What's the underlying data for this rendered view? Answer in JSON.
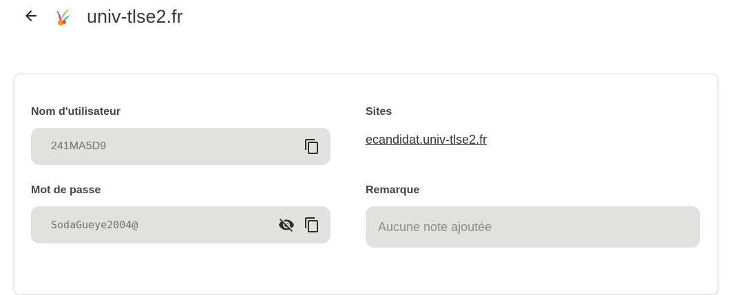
{
  "header": {
    "site_title": "univ-tlse2.fr",
    "back_icon": "arrow-left-icon",
    "logo_icon": "site-favicon"
  },
  "fields": {
    "username": {
      "label": "Nom d'utilisateur",
      "value": "241MA5D9",
      "copy_icon": "copy-icon"
    },
    "password": {
      "label": "Mot de passe",
      "value": "SodaGueye2004@",
      "toggle_icon": "eye-off-icon",
      "copy_icon": "copy-icon"
    },
    "sites": {
      "label": "Sites",
      "links": [
        "ecandidat.univ-tlse2.fr"
      ]
    },
    "note": {
      "label": "Remarque",
      "placeholder": "Aucune note ajoutée"
    }
  },
  "colors": {
    "field_background": "#e1e2e0",
    "card_border": "#e2e2e2",
    "text": "#3c3c3c"
  }
}
